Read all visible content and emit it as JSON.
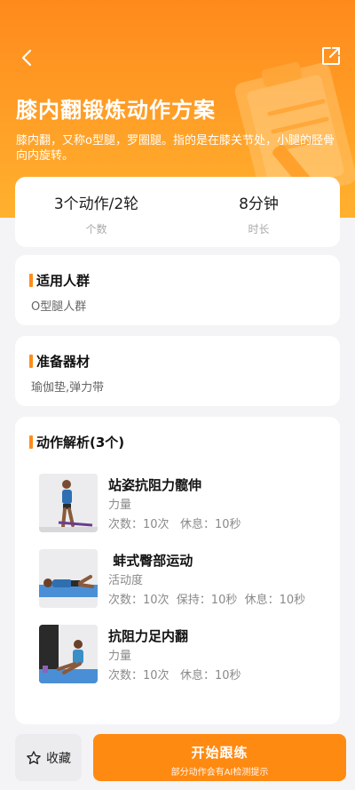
{
  "header": {
    "title": "膝内翻锻炼动作方案",
    "description": "膝内翻，又称o型腿，罗圈腿。指的是在膝关节处，小腿的胫骨向内旋转。"
  },
  "stats": [
    {
      "value": "3个动作/2轮",
      "label": "个数"
    },
    {
      "value": "8分钟",
      "label": "时长"
    }
  ],
  "crowd": {
    "title": "适用人群",
    "text": "O型腿人群"
  },
  "equipment": {
    "title": "准备器材",
    "text": "瑜伽垫,弹力带"
  },
  "actions": {
    "title": "动作解析(3个)",
    "items": [
      {
        "name": "站姿抗阻力髋伸",
        "category": "力量",
        "meta": "次数：10次   休息：10秒"
      },
      {
        "name": " 蚌式臀部运动",
        "category": "活动度",
        "meta": "次数：10次  保持：10秒  休息：10秒"
      },
      {
        "name": "抗阻力足内翻",
        "category": "力量",
        "meta": "次数：10次   休息：10秒"
      }
    ]
  },
  "bottom": {
    "favorite_label": "收藏",
    "start_label": "开始跟练",
    "start_hint": "部分动作会有AI检测提示"
  },
  "colors": {
    "accent": "#ff8a12",
    "hero_top": "#ff8a1c",
    "hero_bottom": "#ffb12e"
  },
  "icons": {
    "back": "chevron-left-icon",
    "share": "share-icon",
    "favorite": "star-icon"
  }
}
